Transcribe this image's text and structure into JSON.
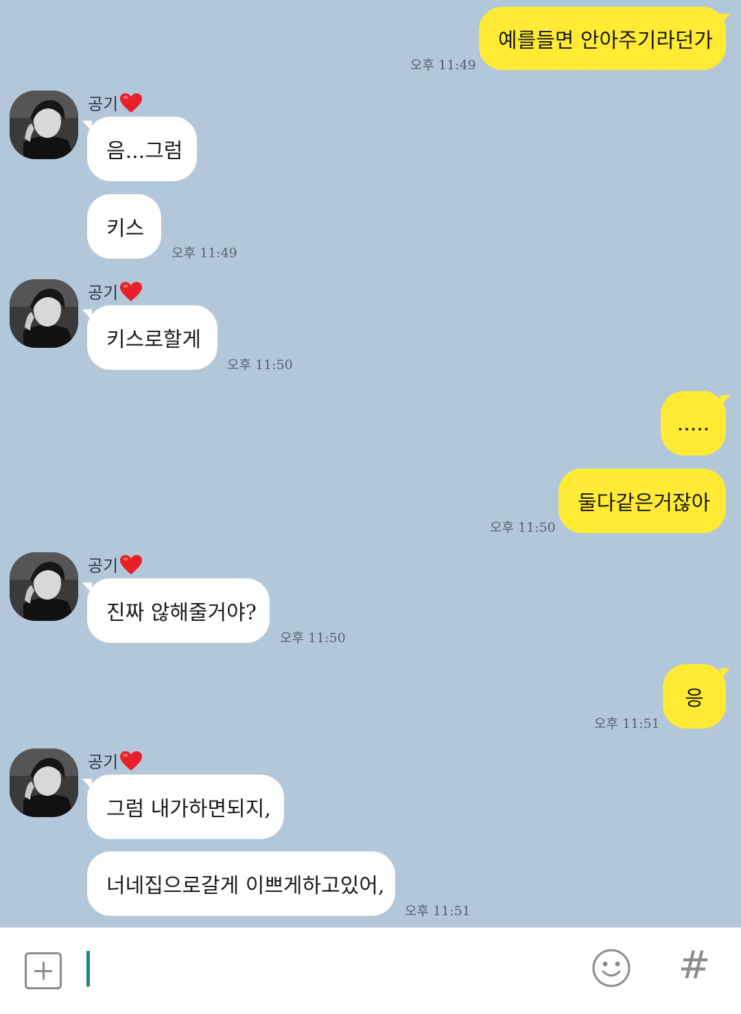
{
  "contact": {
    "name": "공기"
  },
  "messages": {
    "m1": {
      "text": "예를들면 안아주기라던가",
      "time": "오후 11:49"
    },
    "m2": {
      "text": "음...그럼"
    },
    "m3": {
      "text": "키스",
      "time": "오후 11:49"
    },
    "m4": {
      "text": "키스로할게",
      "time": "오후 11:50"
    },
    "m5": {
      "text": "....."
    },
    "m6": {
      "text": "둘다같은거잖아",
      "time": "오후 11:50"
    },
    "m7": {
      "text": "진짜 않해줄거야?",
      "time": "오후 11:50"
    },
    "m8": {
      "text": "응",
      "time": "오후 11:51"
    },
    "m9": {
      "text": "그럼 내가하면되지,"
    },
    "m10": {
      "text": "너네집으로갈게 이쁘게하고있어,",
      "time": "오후 11:51"
    }
  },
  "input": {
    "value": "",
    "placeholder": ""
  },
  "colors": {
    "background": "#b2c7da",
    "my_bubble": "#ffeb33",
    "their_bubble": "#ffffff",
    "cursor": "#1a8a80"
  },
  "icons": {
    "attach": "plus-square-icon",
    "emoji": "smiley-icon",
    "hashtag": "hash-icon",
    "name_suffix": "heart-icon"
  }
}
